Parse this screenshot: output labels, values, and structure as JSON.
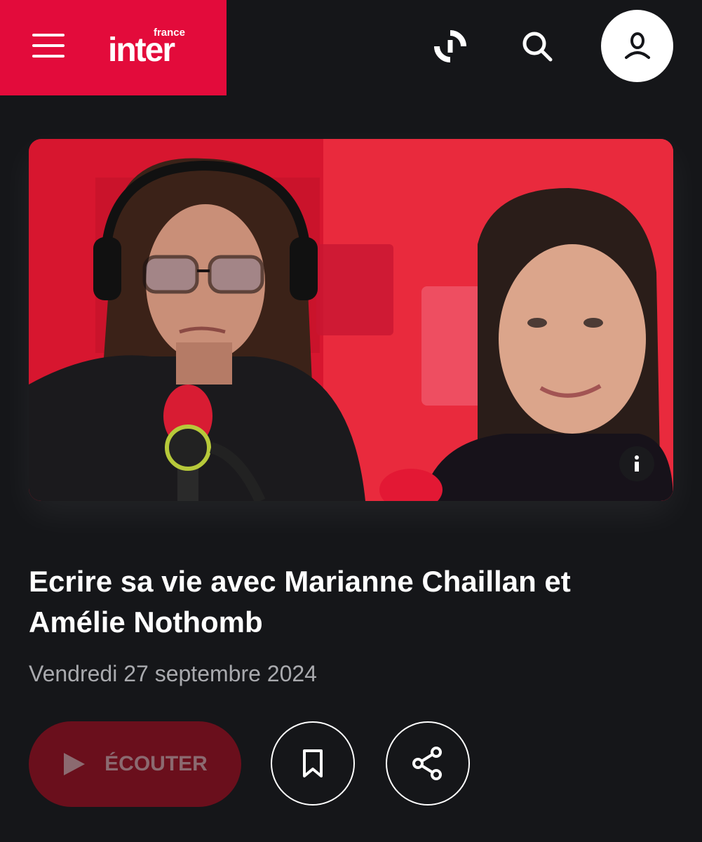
{
  "header": {
    "menu_icon": "hamburger-menu-icon",
    "logo": {
      "top": "france",
      "main": "inter"
    },
    "live_icon": "live-radio-icon",
    "search_icon": "search-icon",
    "account_icon": "user-icon"
  },
  "colors": {
    "brand": "#e30b3b",
    "background": "#151619",
    "listen_button": "#6a0f1c",
    "date_text": "#a9aaae"
  },
  "episode": {
    "image_alt": "Marianne Chaillan et Amélie Nothomb",
    "title": "Ecrire sa vie avec Marianne Chaillan et Amélie Nothomb",
    "date": "Vendredi 27 septembre 2024"
  },
  "actions": {
    "listen_label": "ÉCOUTER",
    "play_icon": "play-icon",
    "bookmark_icon": "bookmark-icon",
    "share_icon": "share-icon",
    "info_icon": "info-icon"
  }
}
